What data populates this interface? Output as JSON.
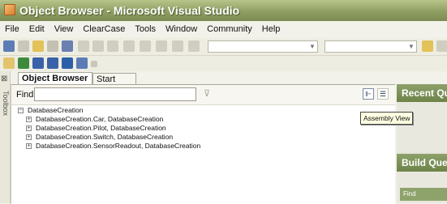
{
  "window": {
    "title": "Object Browser - Microsoft Visual Studio"
  },
  "menu": {
    "items": [
      "File",
      "Edit",
      "View",
      "ClearCase",
      "Tools",
      "Window",
      "Community",
      "Help"
    ]
  },
  "sidebar": {
    "label": "Toolbox"
  },
  "tabs": [
    {
      "label": "Object Browser",
      "active": true
    },
    {
      "label": "Start Page",
      "active": false
    }
  ],
  "find": {
    "label": "Find",
    "value": "",
    "placeholder": ""
  },
  "tree": {
    "root": "DatabaseCreation",
    "items": [
      "DatabaseCreation.Car, DatabaseCreation",
      "DatabaseCreation.Pilot, DatabaseCreation",
      "DatabaseCreation.Switch, DatabaseCreation",
      "DatabaseCreation.SensorReadout, DatabaseCreation"
    ]
  },
  "tooltip": {
    "text": "Assembly View"
  },
  "right_panel": {
    "top_header": "Recent Qu",
    "bottom_header": "Build Quer",
    "field_label": "Find"
  },
  "colors": {
    "titlebar": "#8f9f63",
    "panel_header": "#7d9258",
    "accent_blue": "#3a62a8"
  },
  "icons": [
    "app-icon",
    "new-project-icon",
    "open-icon",
    "save-icon",
    "save-all-icon",
    "cut-icon",
    "copy-icon",
    "paste-icon",
    "undo-icon",
    "redo-icon",
    "navigate-icon",
    "start-icon",
    "solution-explorer-icon",
    "properties-icon",
    "object-browser-icon",
    "toolbox-icon",
    "pin-icon",
    "find-go-icon",
    "assembly-view-icon",
    "list-view-icon"
  ]
}
